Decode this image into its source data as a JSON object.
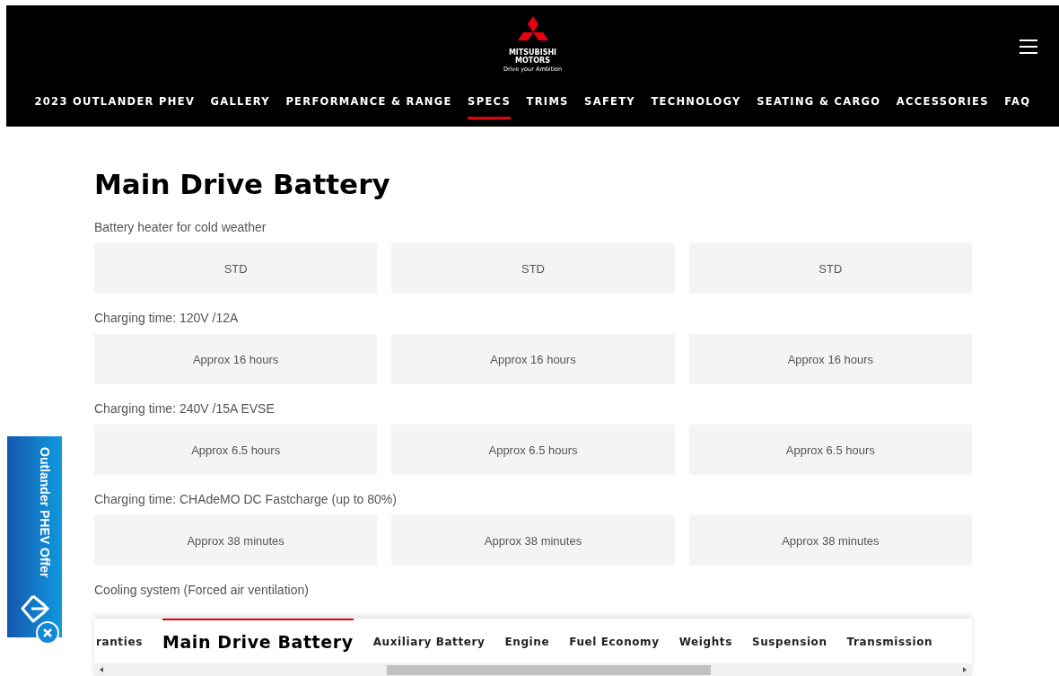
{
  "brand": {
    "name_line1": "MITSUBISHI",
    "name_line2": "MOTORS",
    "tagline": "Drive your Ambition"
  },
  "nav": [
    {
      "label": "2023 OUTLANDER PHEV",
      "selected": false
    },
    {
      "label": "GALLERY",
      "selected": false
    },
    {
      "label": "PERFORMANCE & RANGE",
      "selected": false
    },
    {
      "label": "SPECS",
      "selected": true
    },
    {
      "label": "TRIMS",
      "selected": false
    },
    {
      "label": "SAFETY",
      "selected": false
    },
    {
      "label": "TECHNOLOGY",
      "selected": false
    },
    {
      "label": "SEATING & CARGO",
      "selected": false
    },
    {
      "label": "ACCESSORIES",
      "selected": false
    },
    {
      "label": "FAQ",
      "selected": false
    }
  ],
  "section": {
    "title": "Main Drive Battery",
    "specs": [
      {
        "label": "Battery heater for cold weather",
        "values": [
          "STD",
          "STD",
          "STD"
        ]
      },
      {
        "label": "Charging time: 120V /12A",
        "values": [
          "Approx 16 hours",
          "Approx 16 hours",
          "Approx 16 hours"
        ]
      },
      {
        "label": "Charging time: 240V /15A EVSE",
        "values": [
          "Approx 6.5 hours",
          "Approx 6.5 hours",
          "Approx 6.5 hours"
        ]
      },
      {
        "label": "Charging time: CHAdeMO DC Fastcharge (up to 80%)",
        "values": [
          "Approx 38 minutes",
          "Approx 38 minutes",
          "Approx 38 minutes"
        ]
      },
      {
        "label": "Cooling system (Forced air ventilation)"
      }
    ]
  },
  "offer_tab": {
    "label": "Outlander PHEV Offer"
  },
  "section_tabs": [
    {
      "label": "ranties",
      "selected": false
    },
    {
      "label": "Main Drive Battery",
      "selected": true
    },
    {
      "label": "Auxiliary Battery",
      "selected": false
    },
    {
      "label": "Engine",
      "selected": false
    },
    {
      "label": "Fuel Economy",
      "selected": false
    },
    {
      "label": "Weights",
      "selected": false
    },
    {
      "label": "Suspension",
      "selected": false
    },
    {
      "label": "Transmission",
      "selected": false
    }
  ]
}
